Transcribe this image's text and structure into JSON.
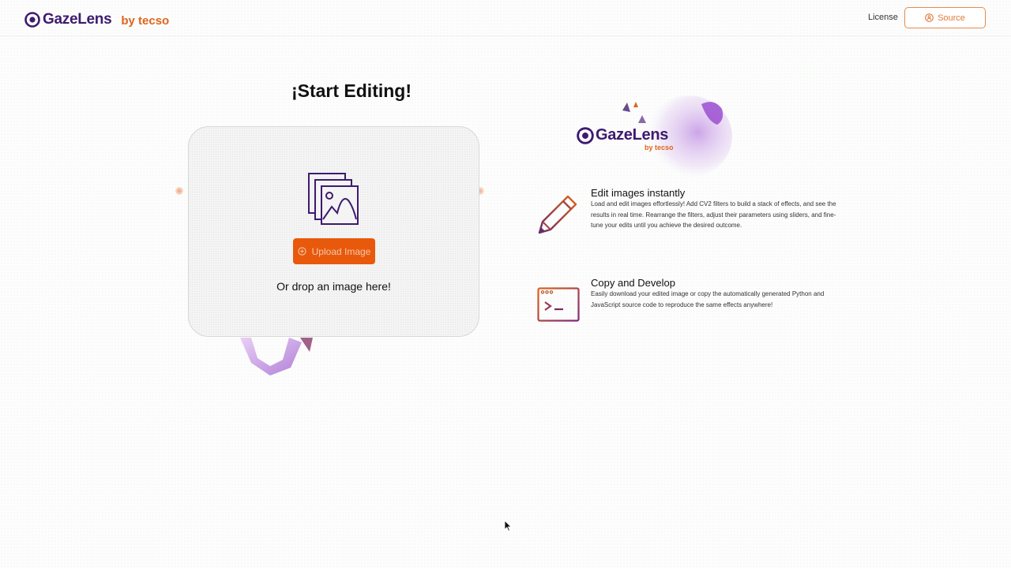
{
  "header": {
    "brand_name": "GazeLens",
    "brand_by": "by tecso",
    "nav_license": "License",
    "source_label": "Source"
  },
  "main": {
    "title": "¡Start Editing!",
    "upload_button": "Upload Image",
    "drop_text": "Or drop an image here!"
  },
  "hero": {
    "brand_name": "GazeLens",
    "brand_by": "by tecso"
  },
  "features": [
    {
      "title": "Edit images instantly",
      "icon": "pencil-icon",
      "text": "Load and edit images effortlessly! Add CV2 filters to build a stack of effects, and see the results in real time. Rearrange the filters, adjust their parameters using sliders, and fine-tune your edits until you achieve the desired outcome."
    },
    {
      "title": "Copy and Develop",
      "icon": "terminal-window-icon",
      "text": "Easily download your edited image or copy the automatically generated Python and JavaScript source code to reproduce the same effects anywhere!"
    }
  ],
  "colors": {
    "brand_purple": "#3e1a70",
    "brand_orange": "#e0641a",
    "button_orange": "#e8590c"
  }
}
